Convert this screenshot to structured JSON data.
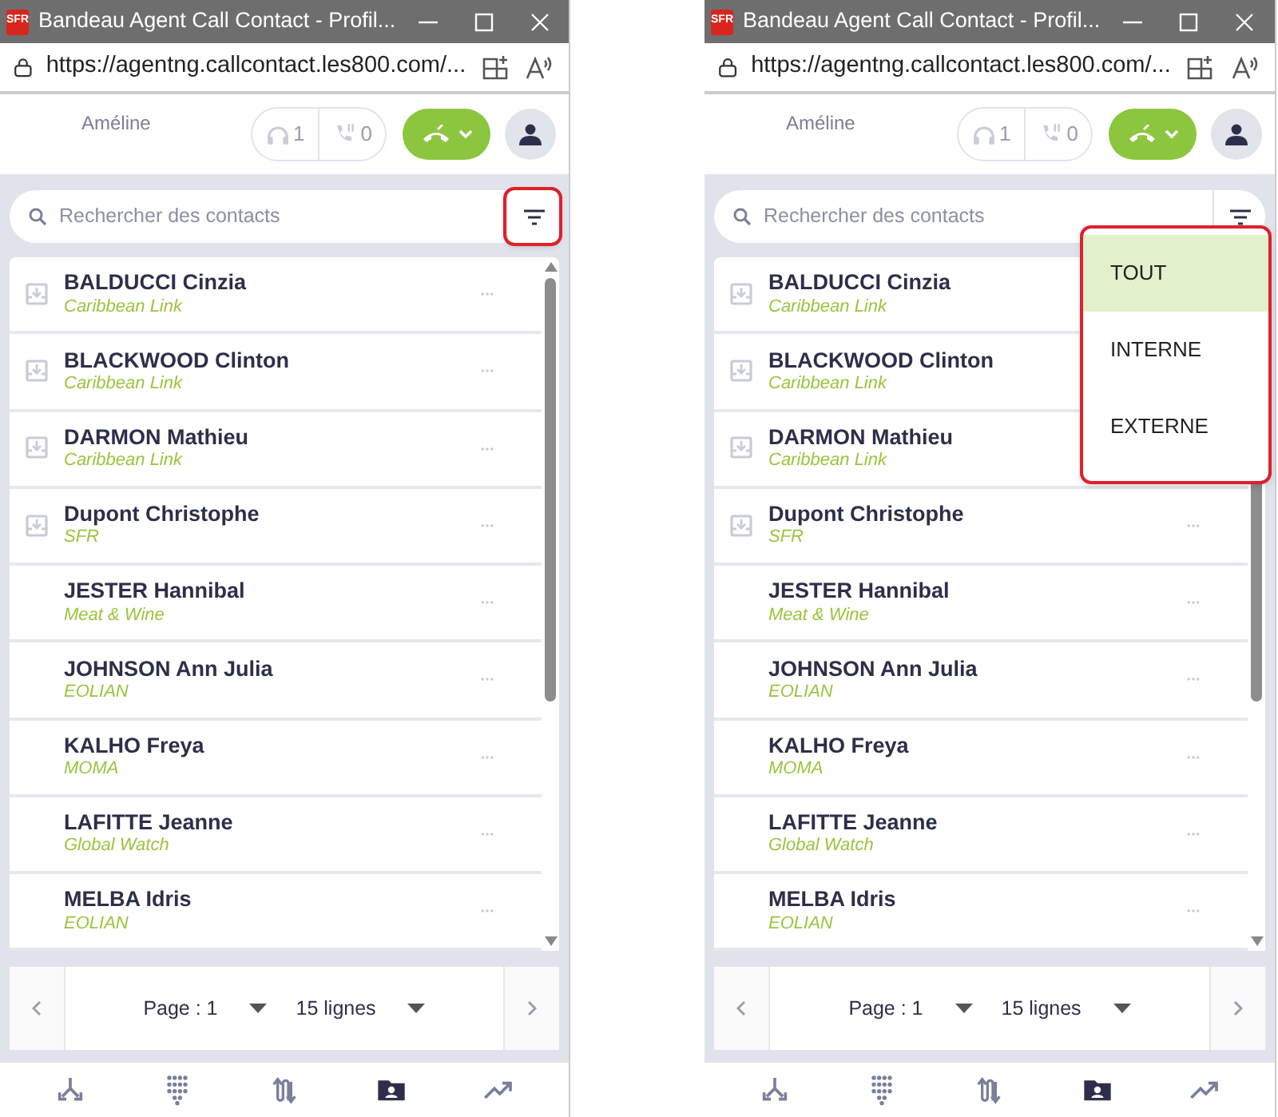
{
  "panels": [
    {
      "window": {
        "logo": "SFR",
        "title": "Bandeau Agent Call Contact - Profil..."
      },
      "address_bar": {
        "url": "https://agentng.callcontact.les800.com/..."
      },
      "header": {
        "agent": "Améline",
        "counters": [
          {
            "kind": "headset",
            "value": "1"
          },
          {
            "kind": "phone",
            "value": "0"
          }
        ]
      },
      "search": {
        "placeholder": "Rechercher des contacts",
        "filter_highlighted": true
      },
      "contacts": [
        {
          "name": "BALDUCCI Cinzia",
          "company": "Caribbean Link",
          "has_icon": true,
          "menu_visible": true
        },
        {
          "name": "BLACKWOOD Clinton",
          "company": "Caribbean Link",
          "has_icon": true,
          "menu_visible": true
        },
        {
          "name": "DARMON Mathieu",
          "company": "Caribbean Link",
          "has_icon": true,
          "menu_visible": true
        },
        {
          "name": "Dupont Christophe",
          "company": "SFR",
          "has_icon": true,
          "menu_visible": true
        },
        {
          "name": "JESTER Hannibal",
          "company": "Meat & Wine",
          "has_icon": false,
          "menu_visible": true
        },
        {
          "name": "JOHNSON Ann Julia",
          "company": "EOLIAN",
          "has_icon": false,
          "menu_visible": true
        },
        {
          "name": "KALHO Freya",
          "company": "MOMA",
          "has_icon": false,
          "menu_visible": true
        },
        {
          "name": "LAFITTE Jeanne",
          "company": "Global Watch",
          "has_icon": false,
          "menu_visible": true
        },
        {
          "name": "MELBA Idris",
          "company": "EOLIAN",
          "has_icon": false,
          "menu_visible": true
        }
      ],
      "pager": {
        "page": "Page : 1",
        "rows": "15 lignes"
      },
      "nav": [
        {
          "kind": "split",
          "selected": false
        },
        {
          "kind": "dialpad",
          "selected": false
        },
        {
          "kind": "swap",
          "selected": false
        },
        {
          "kind": "contacts",
          "selected": true
        },
        {
          "kind": "trend",
          "selected": false
        }
      ]
    },
    {
      "window": {
        "logo": "SFR",
        "title": "Bandeau Agent Call Contact - Profil..."
      },
      "address_bar": {
        "url": "https://agentng.callcontact.les800.com/..."
      },
      "header": {
        "agent": "Améline",
        "counters": [
          {
            "kind": "headset",
            "value": "1"
          },
          {
            "kind": "phone",
            "value": "0"
          }
        ]
      },
      "search": {
        "placeholder": "Rechercher des contacts",
        "filter_highlighted": false
      },
      "filter_menu": {
        "highlighted": true,
        "items": [
          {
            "label": "TOUT",
            "selected": true
          },
          {
            "label": "INTERNE",
            "selected": false
          },
          {
            "label": "EXTERNE",
            "selected": false
          }
        ]
      },
      "contacts": [
        {
          "name": "BALDUCCI Cinzia",
          "company": "Caribbean Link",
          "has_icon": true,
          "menu_visible": false
        },
        {
          "name": "BLACKWOOD Clinton",
          "company": "Caribbean Link",
          "has_icon": true,
          "menu_visible": false
        },
        {
          "name": "DARMON Mathieu",
          "company": "Caribbean Link",
          "has_icon": true,
          "menu_visible": false
        },
        {
          "name": "Dupont Christophe",
          "company": "SFR",
          "has_icon": true,
          "menu_visible": true
        },
        {
          "name": "JESTER Hannibal",
          "company": "Meat & Wine",
          "has_icon": false,
          "menu_visible": true
        },
        {
          "name": "JOHNSON Ann Julia",
          "company": "EOLIAN",
          "has_icon": false,
          "menu_visible": true
        },
        {
          "name": "KALHO Freya",
          "company": "MOMA",
          "has_icon": false,
          "menu_visible": true
        },
        {
          "name": "LAFITTE Jeanne",
          "company": "Global Watch",
          "has_icon": false,
          "menu_visible": true
        },
        {
          "name": "MELBA Idris",
          "company": "EOLIAN",
          "has_icon": false,
          "menu_visible": true
        }
      ],
      "pager": {
        "page": "Page : 1",
        "rows": "15 lignes"
      },
      "nav": [
        {
          "kind": "split",
          "selected": false
        },
        {
          "kind": "dialpad",
          "selected": false
        },
        {
          "kind": "swap",
          "selected": false
        },
        {
          "kind": "contacts",
          "selected": true
        },
        {
          "kind": "trend",
          "selected": false
        }
      ]
    }
  ]
}
